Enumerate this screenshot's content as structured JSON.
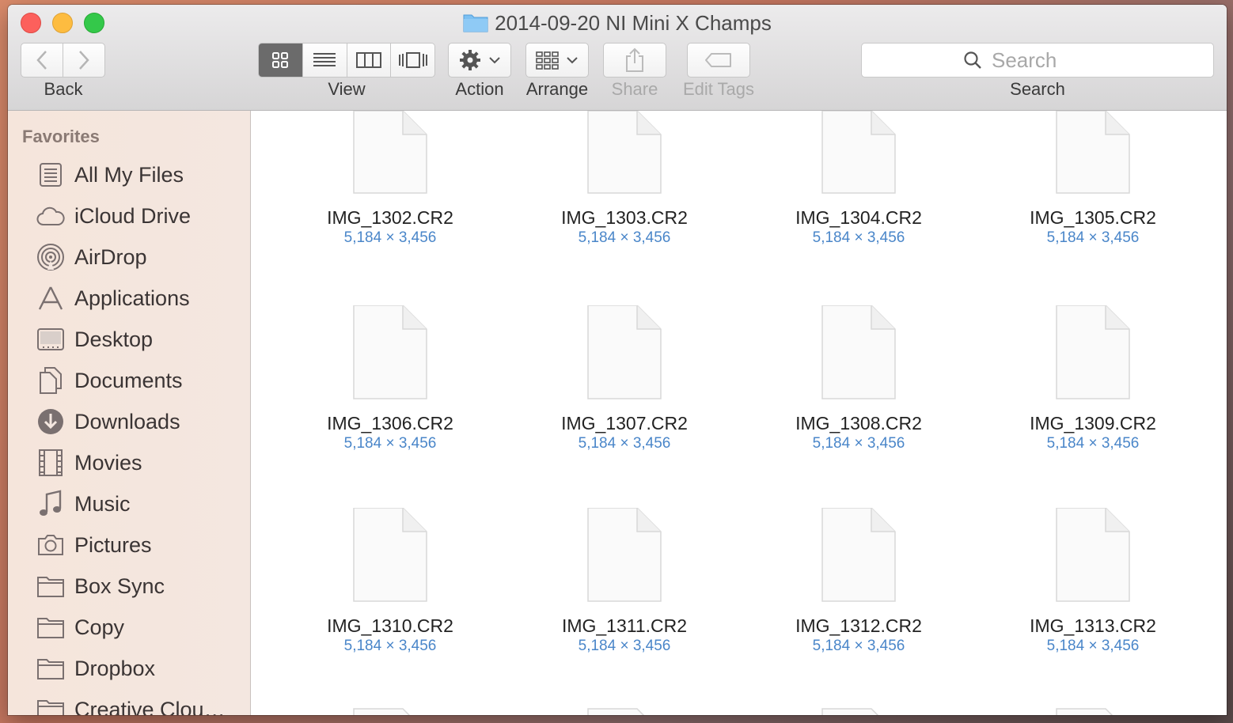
{
  "window": {
    "title": "2014-09-20 NI Mini X Champs"
  },
  "toolbar": {
    "back_label": "Back",
    "view_label": "View",
    "action_label": "Action",
    "arrange_label": "Arrange",
    "share_label": "Share",
    "edit_tags_label": "Edit Tags",
    "search_label": "Search",
    "search_placeholder": "Search"
  },
  "sidebar": {
    "heading": "Favorites",
    "items": [
      {
        "label": "All My Files",
        "icon": "all-files-icon"
      },
      {
        "label": "iCloud Drive",
        "icon": "cloud-icon"
      },
      {
        "label": "AirDrop",
        "icon": "airdrop-icon"
      },
      {
        "label": "Applications",
        "icon": "applications-icon"
      },
      {
        "label": "Desktop",
        "icon": "desktop-icon"
      },
      {
        "label": "Documents",
        "icon": "documents-icon"
      },
      {
        "label": "Downloads",
        "icon": "downloads-icon"
      },
      {
        "label": "Movies",
        "icon": "movies-icon"
      },
      {
        "label": "Music",
        "icon": "music-icon"
      },
      {
        "label": "Pictures",
        "icon": "camera-icon"
      },
      {
        "label": "Box Sync",
        "icon": "folder-icon"
      },
      {
        "label": "Copy",
        "icon": "folder-icon"
      },
      {
        "label": "Dropbox",
        "icon": "folder-icon"
      },
      {
        "label": "Creative Clou…",
        "icon": "folder-icon"
      }
    ]
  },
  "files": [
    {
      "name": "IMG_1302.CR2",
      "meta": "5,184 × 3,456"
    },
    {
      "name": "IMG_1303.CR2",
      "meta": "5,184 × 3,456"
    },
    {
      "name": "IMG_1304.CR2",
      "meta": "5,184 × 3,456"
    },
    {
      "name": "IMG_1305.CR2",
      "meta": "5,184 × 3,456"
    },
    {
      "name": "IMG_1306.CR2",
      "meta": "5,184 × 3,456"
    },
    {
      "name": "IMG_1307.CR2",
      "meta": "5,184 × 3,456"
    },
    {
      "name": "IMG_1308.CR2",
      "meta": "5,184 × 3,456"
    },
    {
      "name": "IMG_1309.CR2",
      "meta": "5,184 × 3,456"
    },
    {
      "name": "IMG_1310.CR2",
      "meta": "5,184 × 3,456"
    },
    {
      "name": "IMG_1311.CR2",
      "meta": "5,184 × 3,456"
    },
    {
      "name": "IMG_1312.CR2",
      "meta": "5,184 × 3,456"
    },
    {
      "name": "IMG_1313.CR2",
      "meta": "5,184 × 3,456"
    }
  ],
  "colors": {
    "meta_text": "#4a86c9",
    "close": "#fc605c",
    "minimize": "#fdbc40",
    "maximize": "#34c84a"
  }
}
